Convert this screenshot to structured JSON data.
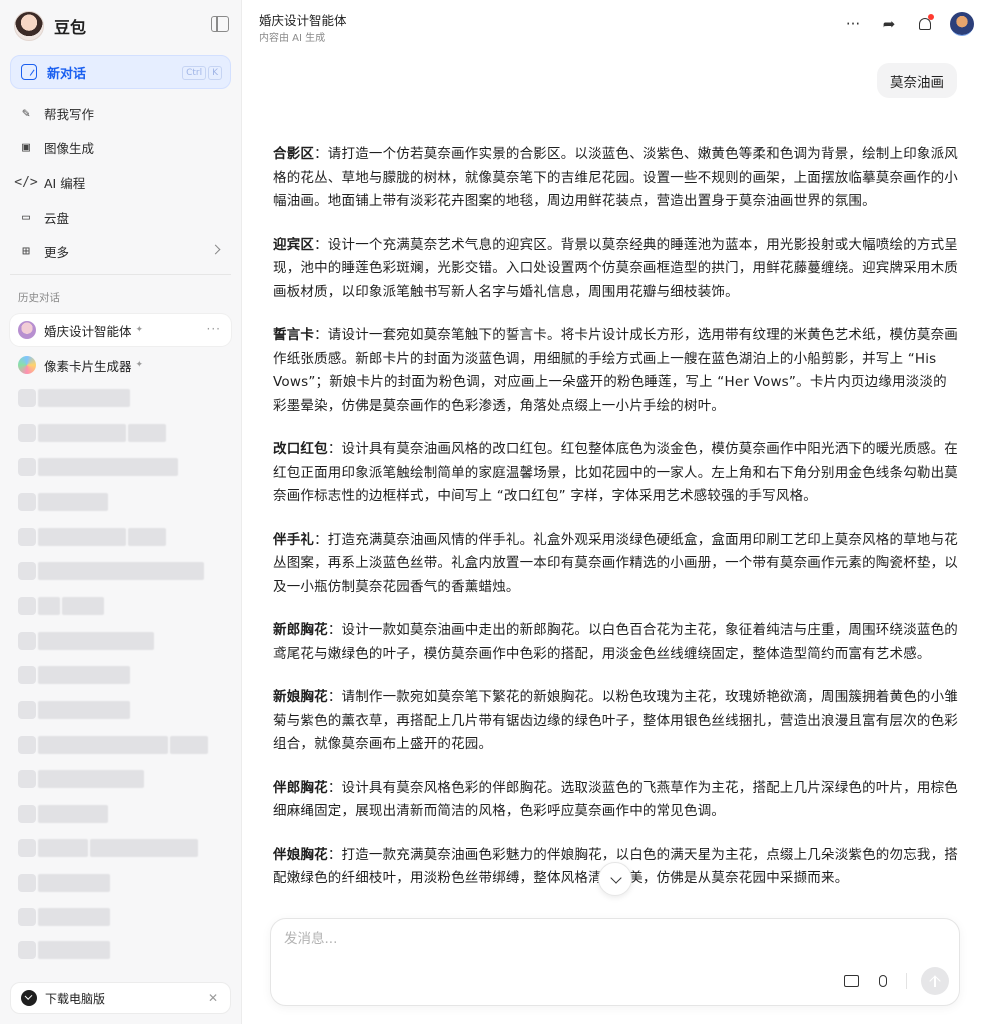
{
  "app": {
    "name": "豆包"
  },
  "sidebar": {
    "new_chat": {
      "label": "新对话",
      "shortcut": [
        "Ctrl",
        "K"
      ]
    },
    "menu": [
      {
        "icon": "pen-icon",
        "label": "帮我写作"
      },
      {
        "icon": "image-icon",
        "label": "图像生成"
      },
      {
        "icon": "code-icon",
        "label": "AI 编程"
      },
      {
        "icon": "cloud-drive-icon",
        "label": "云盘"
      },
      {
        "icon": "grid-icon",
        "label": "更多"
      }
    ],
    "history_title": "历史对话",
    "history": [
      {
        "label": "婚庆设计智能体",
        "pinned": true,
        "active": true
      },
      {
        "label": "像素卡片生成器",
        "pinned": true,
        "active": false
      }
    ],
    "download": {
      "label": "下载电脑版"
    }
  },
  "header": {
    "title": "婚庆设计智能体",
    "subtitle": "内容由 AI 生成"
  },
  "chat": {
    "user_message": "莫奈油画",
    "paragraphs": [
      {
        "term": "合影区",
        "text": "：请打造一个仿若莫奈画作实景的合影区。以淡蓝色、淡紫色、嫩黄色等柔和色调为背景，绘制上印象派风格的花丛、草地与朦胧的树林，就像莫奈笔下的吉维尼花园。设置一些不规则的画架，上面摆放临摹莫奈画作的小幅油画。地面铺上带有淡彩花卉图案的地毯，周边用鲜花装点，营造出置身于莫奈油画世界的氛围。"
      },
      {
        "term": "迎宾区",
        "text": "：设计一个充满莫奈艺术气息的迎宾区。背景以莫奈经典的睡莲池为蓝本，用光影投射或大幅喷绘的方式呈现，池中的睡莲色彩斑斓，光影交错。入口处设置两个仿莫奈画框造型的拱门，用鲜花藤蔓缠绕。迎宾牌采用木质画板材质，以印象派笔触书写新人名字与婚礼信息，周围用花瓣与细枝装饰。"
      },
      {
        "term": "誓言卡",
        "text": "：请设计一套宛如莫奈笔触下的誓言卡。将卡片设计成长方形，选用带有纹理的米黄色艺术纸，模仿莫奈画作纸张质感。新郎卡片的封面为淡蓝色调，用细腻的手绘方式画上一艘在蓝色湖泊上的小船剪影，并写上 “His Vows”；新娘卡片的封面为粉色调，对应画上一朵盛开的粉色睡莲，写上 “Her Vows”。卡片内页边缘用淡淡的彩墨晕染，仿佛是莫奈画作的色彩渗透，角落处点缀上一小片手绘的树叶。"
      },
      {
        "term": "改口红包",
        "text": "：设计具有莫奈油画风格的改口红包。红包整体底色为淡金色，模仿莫奈画作中阳光洒下的暖光质感。在红包正面用印象派笔触绘制简单的家庭温馨场景，比如花园中的一家人。左上角和右下角分别用金色线条勾勒出莫奈画作标志性的边框样式，中间写上 “改口红包” 字样，字体采用艺术感较强的手写风格。"
      },
      {
        "term": "伴手礼",
        "text": "：打造充满莫奈油画风情的伴手礼。礼盒外观采用淡绿色硬纸盒，盒面用印刷工艺印上莫奈风格的草地与花丛图案，再系上淡蓝色丝带。礼盒内放置一本印有莫奈画作精选的小画册，一个带有莫奈画作元素的陶瓷杯垫，以及一小瓶仿制莫奈花园香气的香薰蜡烛。"
      },
      {
        "term": "新郎胸花",
        "text": "：设计一款如莫奈油画中走出的新郎胸花。以白色百合花为主花，象征着纯洁与庄重，周围环绕淡蓝色的鸢尾花与嫩绿色的叶子，模仿莫奈画作中色彩的搭配，用淡金色丝线缠绕固定，整体造型简约而富有艺术感。"
      },
      {
        "term": "新娘胸花",
        "text": "：请制作一款宛如莫奈笔下繁花的新娘胸花。以粉色玫瑰为主花，玫瑰娇艳欲滴，周围簇拥着黄色的小雏菊与紫色的薰衣草，再搭配上几片带有锯齿边缘的绿色叶子，整体用银色丝线捆扎，营造出浪漫且富有层次的色彩组合，就像莫奈画布上盛开的花园。"
      },
      {
        "term": "伴郎胸花",
        "text": "：设计具有莫奈风格色彩的伴郎胸花。选取淡蓝色的飞燕草作为主花，搭配上几片深绿色的叶片，用棕色细麻绳固定，展现出清新而简洁的风格，色彩呼应莫奈画作中的常见色调。"
      },
      {
        "term": "伴娘胸花",
        "text": "：打造一款充满莫奈油画色彩魅力的伴娘胸花，以白色的满天星为主花，点缀上几朵淡紫色的勿忘我，搭配嫩绿色的纤细枝叶，用淡粉色丝带绑缚，整体风格清新甜美，仿佛是从莫奈花园中采撷而来。"
      }
    ]
  },
  "composer": {
    "placeholder": "发消息..."
  }
}
